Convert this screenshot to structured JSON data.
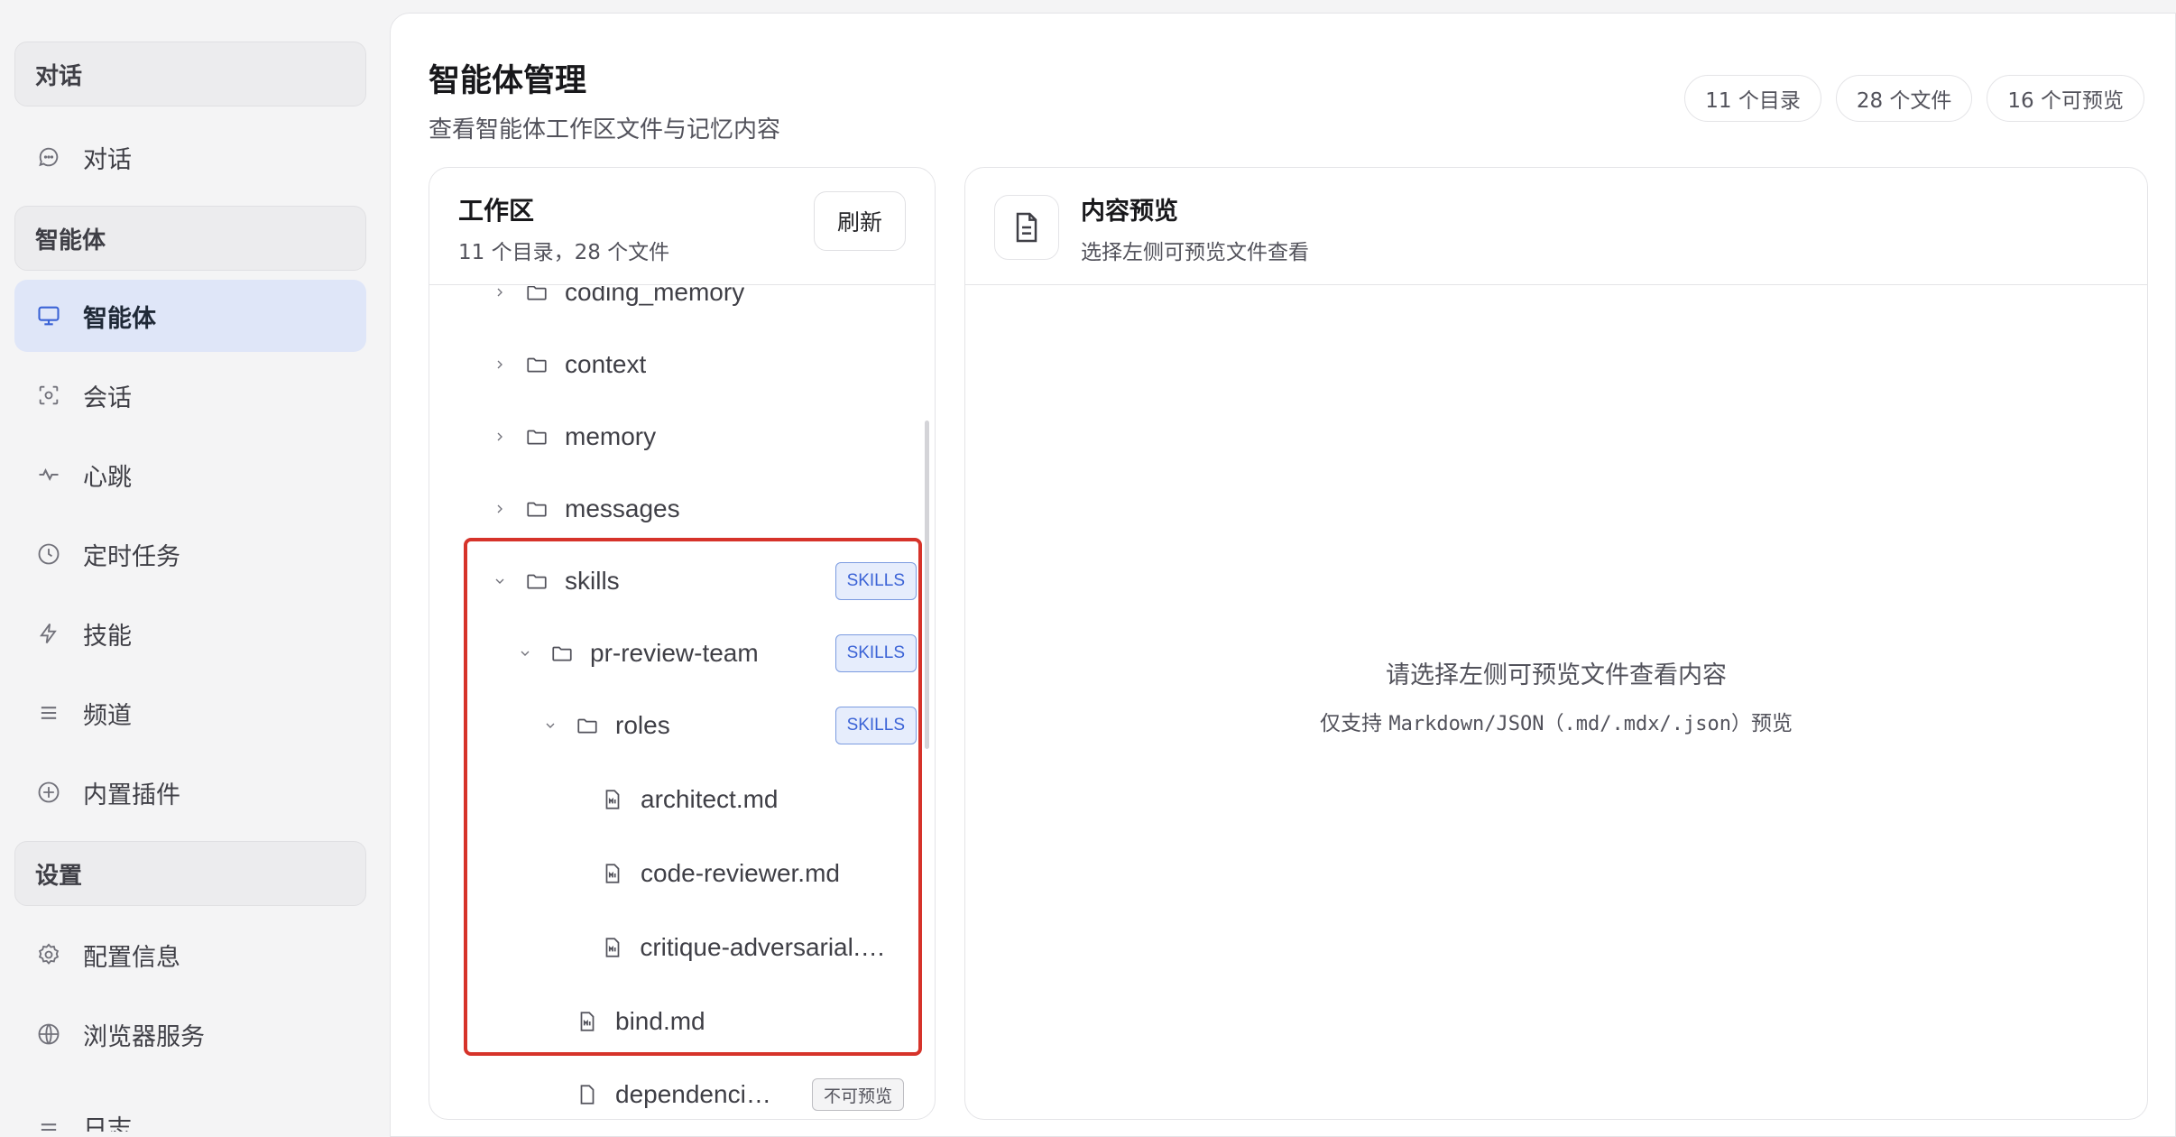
{
  "sidebar": {
    "groups": {
      "chat": "对话",
      "agent": "智能体",
      "settings": "设置"
    },
    "items": {
      "chat": "对话",
      "agent": "智能体",
      "session": "会话",
      "heartbeat": "心跳",
      "scheduled_tasks": "定时任务",
      "skills": "技能",
      "channels": "频道",
      "builtin_plugins": "内置插件",
      "config_info": "配置信息",
      "browser_service": "浏览器服务",
      "logs": "日志"
    }
  },
  "header": {
    "title": "智能体管理",
    "subtitle": "查看智能体工作区文件与记忆内容",
    "stats": {
      "dirs": "11 个目录",
      "files": "28 个文件",
      "previewable": "16 个可预览"
    }
  },
  "workspace": {
    "title": "工作区",
    "summary": "11 个目录，28 个文件",
    "refresh_label": "刷新",
    "tree": {
      "coding_memory": "coding_memory",
      "context": "context",
      "memory": "memory",
      "messages": "messages",
      "skills": "skills",
      "pr_review_team": "pr-review-team",
      "roles": "roles",
      "architect": "architect.md",
      "code_reviewer": "code-reviewer.md",
      "critique": "critique-adversarial.md",
      "bind": "bind.md",
      "dependencies": "dependencies.json"
    },
    "badges": {
      "skills": "SKILLS",
      "not_previewable": "不可预览"
    }
  },
  "preview": {
    "title": "内容预览",
    "subtitle": "选择左侧可预览文件查看",
    "empty_main": "请选择左侧可预览文件查看内容",
    "empty_sub_prefix": "仅支持 ",
    "empty_sub_formats": "Markdown/JSON（.md/.mdx/.json）",
    "empty_sub_suffix": "预览"
  },
  "colors": {
    "accent": "#3b63d6",
    "active_bg": "#dfe6f8",
    "highlight_border": "#d6332a"
  }
}
